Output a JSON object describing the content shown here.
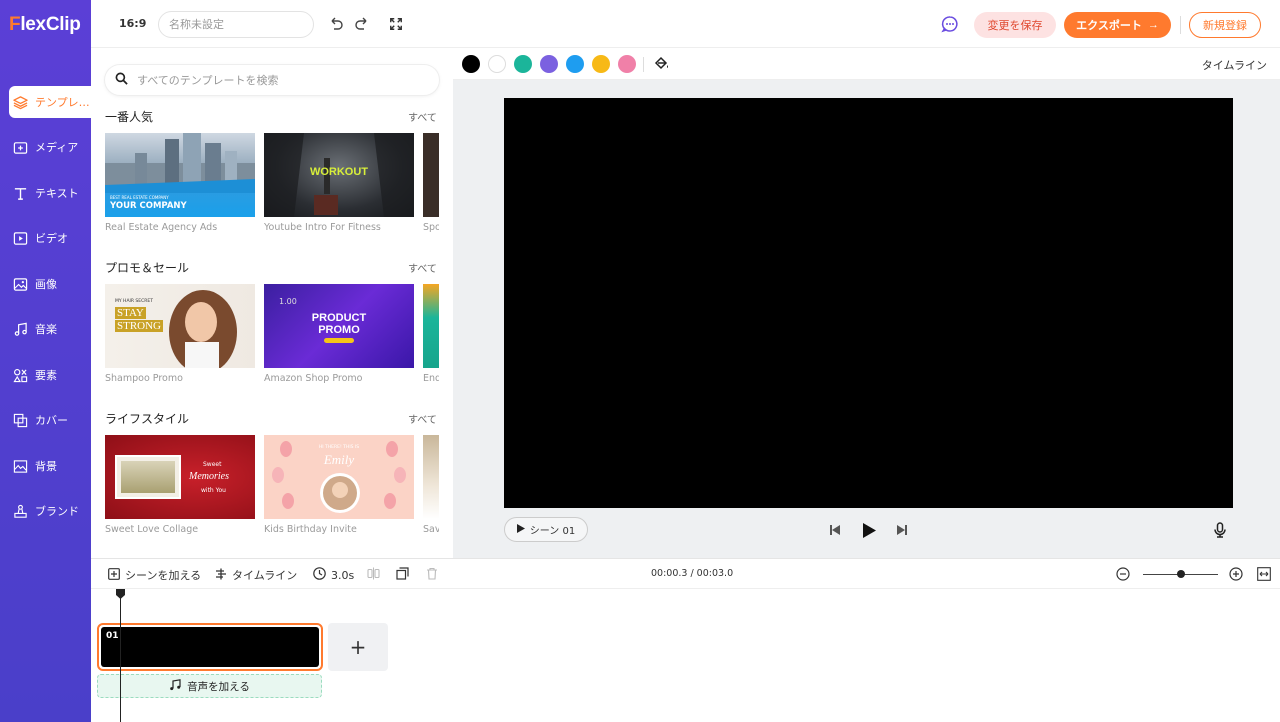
{
  "sidebar": {
    "logo_prefix": "F",
    "logo_rest": "lexClip",
    "items": [
      {
        "label": "テンプレ…",
        "icon": "layers-icon"
      },
      {
        "label": "メディア",
        "icon": "media-icon"
      },
      {
        "label": "テキスト",
        "icon": "text-icon"
      },
      {
        "label": "ビデオ",
        "icon": "video-icon"
      },
      {
        "label": "画像",
        "icon": "image-icon"
      },
      {
        "label": "音楽",
        "icon": "music-icon"
      },
      {
        "label": "要素",
        "icon": "elements-icon"
      },
      {
        "label": "カバー",
        "icon": "cover-icon"
      },
      {
        "label": "背景",
        "icon": "background-icon"
      },
      {
        "label": "ブランド",
        "icon": "brand-icon"
      }
    ]
  },
  "topbar": {
    "ratio": "16:9",
    "title_placeholder": "名称未設定",
    "save_label": "変更を保存",
    "export_label": "エクスポート",
    "signup_label": "新規登録"
  },
  "panel": {
    "search_placeholder": "すべてのテンプレートを検索",
    "see_all": "すべて",
    "sections": [
      {
        "title": "一番人気",
        "templates": [
          {
            "name": "Real Estate Agency Ads",
            "overlay_small": "BEST REAL ESTATE COMPANY",
            "overlay": "YOUR COMPANY"
          },
          {
            "name": "Youtube Intro For Fitness",
            "overlay": "WORKOUT"
          },
          {
            "name": "Spo"
          }
        ]
      },
      {
        "title": "プロモ＆セール",
        "templates": [
          {
            "name": "Shampoo Promo",
            "overlay_small": "MY HAIR SECRET",
            "overlay": "STAY",
            "overlay2": "STRONG"
          },
          {
            "name": "Amazon Shop Promo",
            "overlay_small": "1.00",
            "overlay": "PRODUCT",
            "overlay2": "PROMO"
          },
          {
            "name": "End"
          }
        ]
      },
      {
        "title": "ライフスタイル",
        "templates": [
          {
            "name": "Sweet Love Collage",
            "overlay_small": "Sweet",
            "overlay": "Memories",
            "overlay2": "with You"
          },
          {
            "name": "Kids Birthday Invite",
            "overlay_small": "HI THERE! THIS IS",
            "overlay": "Emily"
          },
          {
            "name": "Sav"
          }
        ]
      }
    ]
  },
  "colorbar": {
    "swatches": [
      "#000000",
      "#ffffff",
      "#1bb59a",
      "#7b61e0",
      "#1e9df0",
      "#f7b916",
      "#f080a8"
    ],
    "timeline_label": "タイムライン"
  },
  "stage": {
    "scene_label": "シーン 01"
  },
  "timeline": {
    "add_scene_label": "シーンを加える",
    "timeline_label": "タイムライン",
    "duration_label": "3.0s",
    "time_readout": "00:00.3 / 00:03.0",
    "clip_number": "01",
    "add_clip_label": "+",
    "add_audio_label": "音声を加える",
    "zoom_level": 0.5
  }
}
